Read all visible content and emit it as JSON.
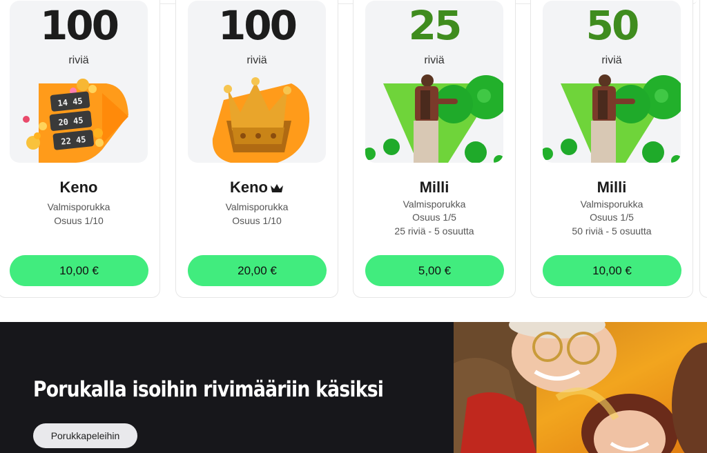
{
  "cards": [
    {
      "number": "100",
      "unit": "riviä",
      "title": "Keno",
      "lines": [
        "Valmisporukka",
        "Osuus 1/10"
      ],
      "price": "10,00 €"
    },
    {
      "number": "100",
      "unit": "riviä",
      "title": "Keno",
      "lines": [
        "Valmisporukka",
        "Osuus 1/10"
      ],
      "price": "20,00 €"
    },
    {
      "number": "25",
      "unit": "riviä",
      "title": "Milli",
      "lines": [
        "Valmisporukka",
        "Osuus 1/5",
        "25 riviä - 5 osuutta"
      ],
      "price": "5,00 €"
    },
    {
      "number": "50",
      "unit": "riviä",
      "title": "Milli",
      "lines": [
        "Valmisporukka",
        "Osuus 1/5",
        "50 riviä - 5 osuutta"
      ],
      "price": "10,00 €"
    }
  ],
  "keno_art_numbers": [
    "14 45",
    "20 45",
    "22 45"
  ],
  "promo": {
    "title": "Porukalla isoihin rivimääriin käsiksi",
    "button": "Porukkapeleihin"
  },
  "colors": {
    "price_button": "#41ec7e",
    "number_green": "#3f8c1e",
    "keno_orange": "#ff9b1a",
    "milli_green": "#6fd43a",
    "promo_background": "#17171b"
  }
}
